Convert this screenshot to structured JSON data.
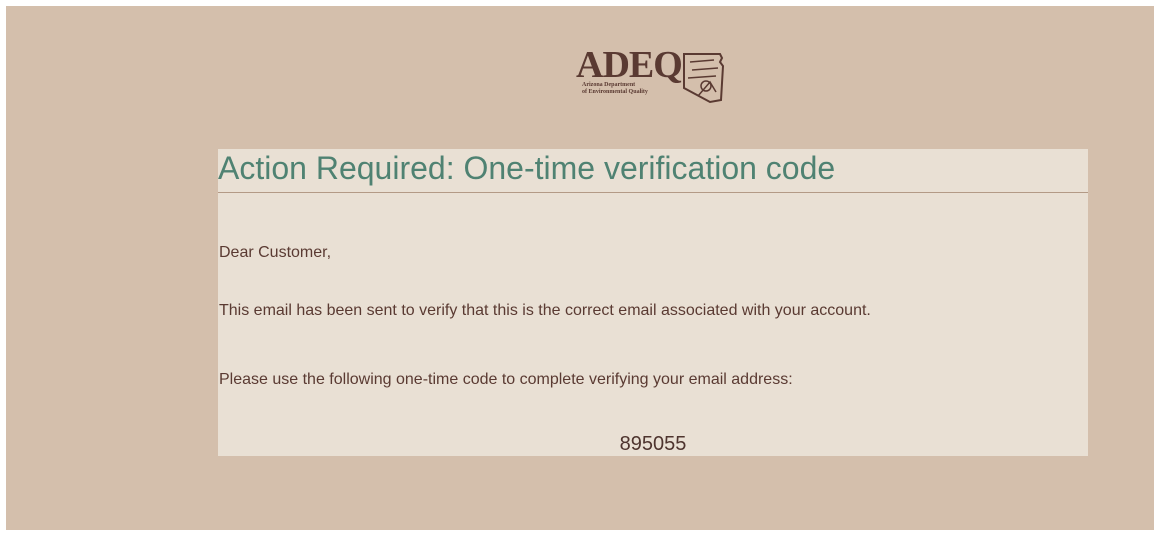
{
  "logo": {
    "wordmark": "ADEQ",
    "subtitle_line1": "Arizona Department",
    "subtitle_line2": "of Environmental Quality",
    "icon": "arizona-state-icon"
  },
  "email": {
    "title": "Action Required: One-time verification code",
    "greeting": "Dear Customer,",
    "body_line1": "This email has been sent to verify that this is the correct email associated with your account.",
    "body_line2": "Please use the following one-time code to complete verifying your email address:",
    "code": "895055"
  },
  "colors": {
    "background": "#d4bfac",
    "card": "#e9e0d4",
    "title": "#4f8272",
    "text": "#5a3a32"
  }
}
